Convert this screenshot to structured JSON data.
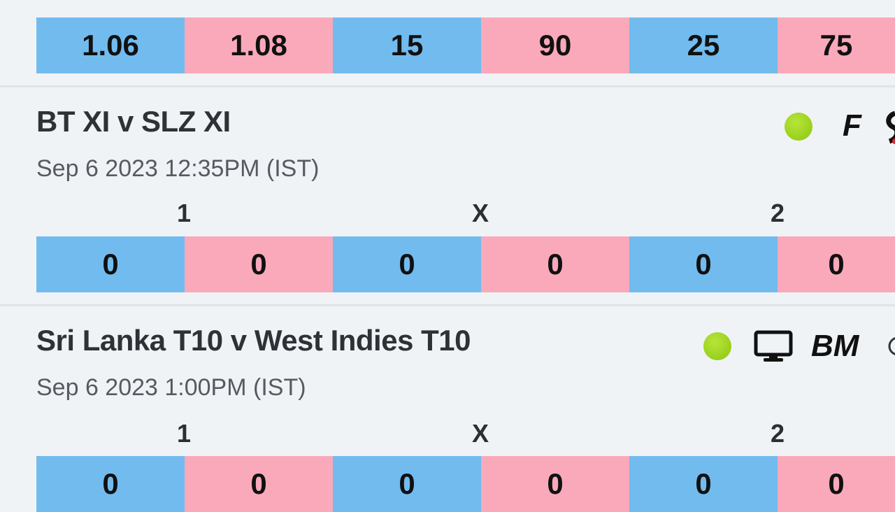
{
  "column_labels": {
    "home": "1",
    "draw": "X",
    "away": "2"
  },
  "matches": [
    {
      "odds": [
        "1.06",
        "1.08",
        "15",
        "90",
        "25",
        "75"
      ]
    },
    {
      "title": "BT XI v SLZ XI",
      "time": "Sep 6 2023 12:35PM (IST)",
      "live": true,
      "badge": "F",
      "odds": [
        "0",
        "0",
        "0",
        "0",
        "0",
        "0"
      ]
    },
    {
      "title": "Sri Lanka T10 v West Indies T10",
      "time": "Sep 6 2023 1:00PM (IST)",
      "live": true,
      "tv": "tv-icon",
      "badge": "BM",
      "odds": [
        "0",
        "0",
        "0",
        "0",
        "0",
        "0"
      ]
    }
  ],
  "colors": {
    "back": "#72bbef",
    "lay": "#faa9ba",
    "live": "#8cc60f",
    "background": "#f0f3f6"
  }
}
